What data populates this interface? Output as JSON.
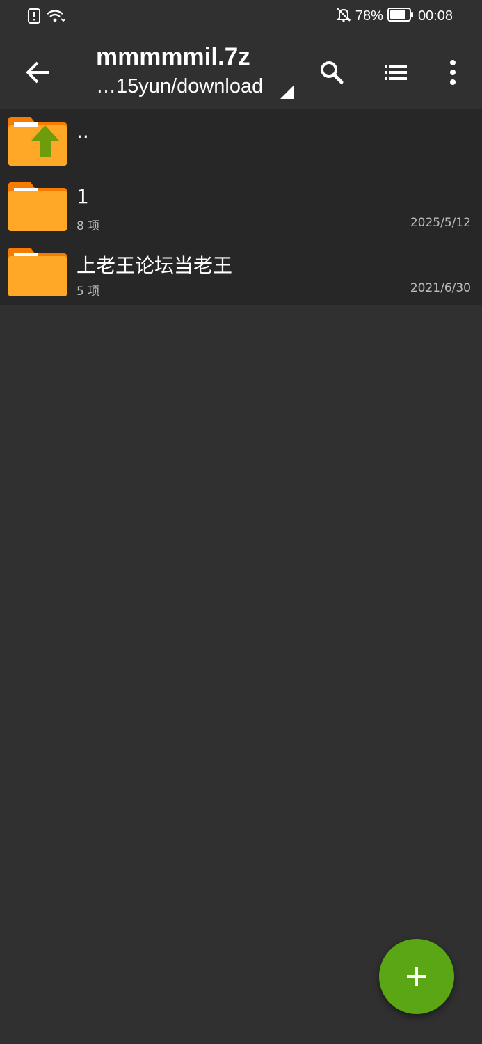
{
  "status_bar": {
    "battery_percent": "78%",
    "time": "00:08",
    "icons": [
      "alert-icon",
      "wifi-icon",
      "notifications-off-icon",
      "battery-icon"
    ]
  },
  "toolbar": {
    "title": "mmmmmil.7z",
    "path": "…15yun/download",
    "icons": [
      "back-arrow-icon",
      "search-icon",
      "list-view-icon",
      "more-vert-icon"
    ]
  },
  "files": [
    {
      "name": "..",
      "meta": "",
      "date": "",
      "icon": "folder-up-icon"
    },
    {
      "name": "1",
      "meta": "8 项",
      "date": "2025/5/12",
      "icon": "folder-icon"
    },
    {
      "name": "上老王论坛当老王",
      "meta": "5 项",
      "date": "2021/6/30",
      "icon": "folder-icon"
    }
  ],
  "fab": {
    "icon": "add-icon"
  },
  "colors": {
    "background": "#303030",
    "list_background": "#272727",
    "folder_orange": "#ffa726",
    "folder_tab": "#f57c00",
    "up_arrow_green": "#6e9c0a",
    "fab_green": "#5aa614"
  }
}
